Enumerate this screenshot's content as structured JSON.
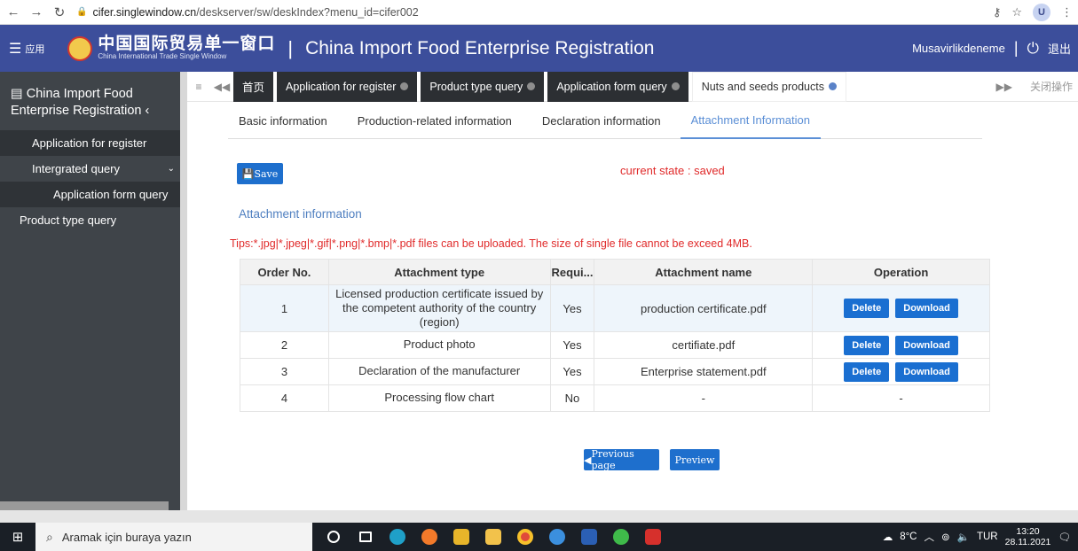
{
  "browser": {
    "url_host": "cifer.singlewindow.cn",
    "url_path": "/deskserver/sw/deskIndex?menu_id=cifer002",
    "profile_initial": "U"
  },
  "header": {
    "menu_label": "应用",
    "brand_cn": "中国国际贸易单一窗口",
    "brand_en": "China International Trade Single Window",
    "title": "China Import Food Enterprise Registration",
    "username": "Musavirlikdeneme",
    "logout_label": "退出"
  },
  "sidebar": {
    "title": "China Import Food Enterprise Registration",
    "items": [
      {
        "label": "Application for register"
      },
      {
        "label": "Intergrated query"
      },
      {
        "label": "Application form query"
      },
      {
        "label": "Product type query"
      }
    ]
  },
  "tabs": {
    "home": "首页",
    "items": [
      {
        "label": "Application for register"
      },
      {
        "label": "Product type query"
      },
      {
        "label": "Application form query"
      },
      {
        "label": "Nuts and seeds products"
      }
    ],
    "close_ops": "关闭操作"
  },
  "subtabs": [
    {
      "label": "Basic information"
    },
    {
      "label": "Production-related information"
    },
    {
      "label": "Declaration information"
    },
    {
      "label": "Attachment Information"
    }
  ],
  "form": {
    "save_label": "Save",
    "state": "current state : saved",
    "section_title": "Attachment information",
    "tips": "Tips:*.jpg|*.jpeg|*.gif|*.png|*.bmp|*.pdf files can be uploaded. The size of single file cannot be exceed 4MB."
  },
  "table": {
    "headers": {
      "order": "Order No.",
      "type": "Attachment type",
      "required": "Requi...",
      "name": "Attachment name",
      "operation": "Operation"
    },
    "delete_label": "Delete",
    "download_label": "Download",
    "rows": [
      {
        "order": "1",
        "type": "Licensed production certificate issued by the competent authority of the country (region)",
        "required": "Yes",
        "name": "production certificate.pdf"
      },
      {
        "order": "2",
        "type": "Product photo",
        "required": "Yes",
        "name": "certifiate.pdf"
      },
      {
        "order": "3",
        "type": "Declaration of the manufacturer",
        "required": "Yes",
        "name": "Enterprise statement.pdf"
      },
      {
        "order": "4",
        "type": "Processing flow chart",
        "required": "No",
        "name": "-",
        "operation": "-"
      }
    ]
  },
  "footer_buttons": {
    "previous": "Previous page",
    "preview": "Preview"
  },
  "taskbar": {
    "search_placeholder": "Aramak için buraya yazın",
    "weather": "8°C",
    "lang": "TUR",
    "time": "13:20",
    "date": "28.11.2021"
  }
}
